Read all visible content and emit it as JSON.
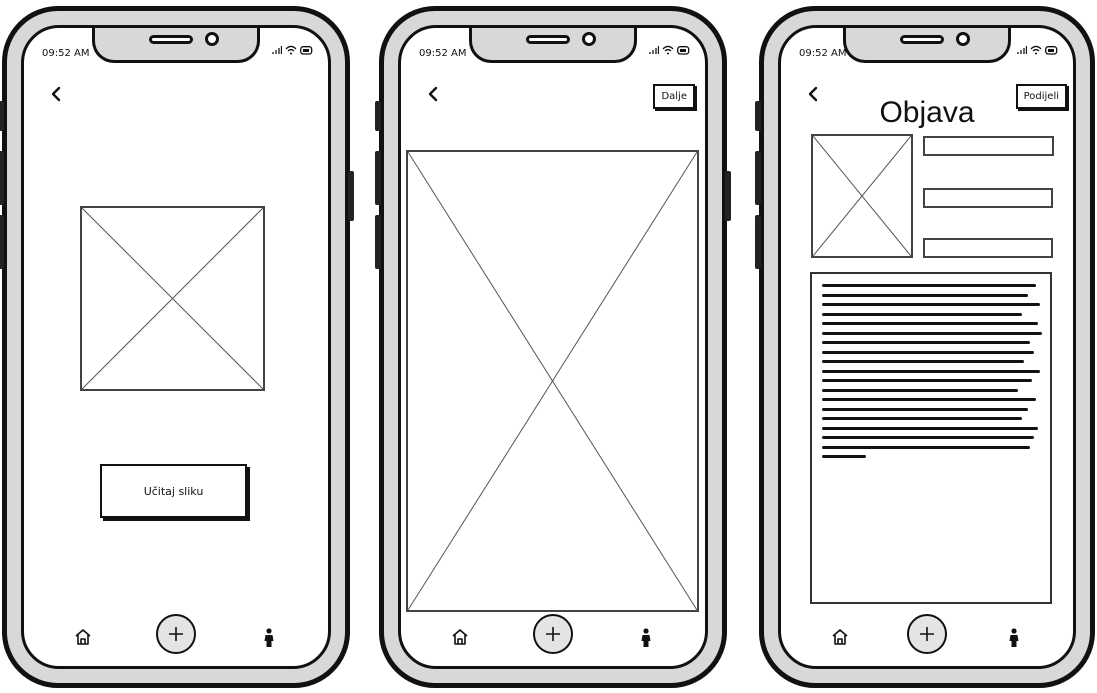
{
  "status_bar": {
    "time": "09:52 AM"
  },
  "screens": [
    {
      "id": "upload",
      "upload_button": "Učitaj sliku"
    },
    {
      "id": "preview",
      "next_button": "Dalje"
    },
    {
      "id": "post",
      "title": "Objava",
      "share_button": "Podijeli"
    }
  ],
  "nav": {
    "items": [
      "home-icon",
      "add-icon",
      "profile-icon"
    ]
  },
  "icons": [
    "chevron-left-icon",
    "signal-icon",
    "wifi-icon",
    "battery-icon",
    "image-placeholder-icon"
  ],
  "colors": {
    "frame": "#111111",
    "bezel": "#d8d8d8",
    "screen": "#ffffff",
    "add_button": "#e4e4e4"
  }
}
